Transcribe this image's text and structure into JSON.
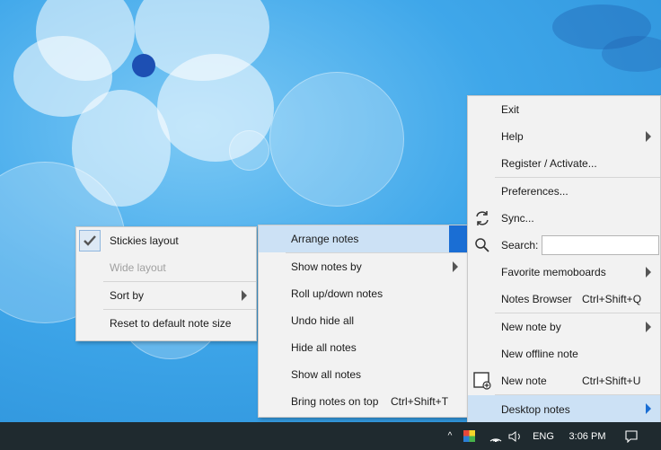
{
  "left_menu": {
    "items": [
      {
        "label": "Stickies layout",
        "checked": true
      },
      {
        "label": "Wide layout",
        "disabled": true
      },
      {
        "label": "Sort by",
        "submenu": true
      },
      {
        "label": "Reset to default note size"
      }
    ]
  },
  "mid_menu": {
    "items": [
      {
        "label": "Arrange notes",
        "highlighted": true
      },
      {
        "label": "Show notes by",
        "submenu": true
      },
      {
        "label": "Roll up/down notes"
      },
      {
        "label": "Undo hide all"
      },
      {
        "label": "Hide all notes"
      },
      {
        "label": "Show all notes"
      },
      {
        "label": "Bring notes on top",
        "shortcut": "Ctrl+Shift+T"
      }
    ]
  },
  "right_menu": {
    "items": [
      {
        "label": "Exit"
      },
      {
        "label": "Help",
        "submenu": true
      },
      {
        "label": "Register / Activate..."
      },
      {
        "label": "Preferences..."
      },
      {
        "label": "Sync...",
        "icon": "sync-icon"
      },
      {
        "label": "Search:",
        "icon": "search-icon",
        "input_value": ""
      },
      {
        "label": "Favorite memoboards",
        "submenu": true
      },
      {
        "label": "Notes Browser",
        "shortcut": "Ctrl+Shift+Q"
      },
      {
        "label": "New note by",
        "submenu": true
      },
      {
        "label": "New offline note"
      },
      {
        "label": "New note",
        "shortcut": "Ctrl+Shift+U",
        "icon": "new-note-icon"
      },
      {
        "label": "Desktop notes",
        "submenu": true,
        "highlighted": true
      }
    ]
  },
  "taskbar": {
    "language": "ENG",
    "time": "3:06 PM"
  },
  "colors": {
    "highlight": "#cce1f5",
    "accent": "#1a6ed4",
    "menu_bg": "#f2f2f2",
    "taskbar": "#1f2a2f"
  }
}
